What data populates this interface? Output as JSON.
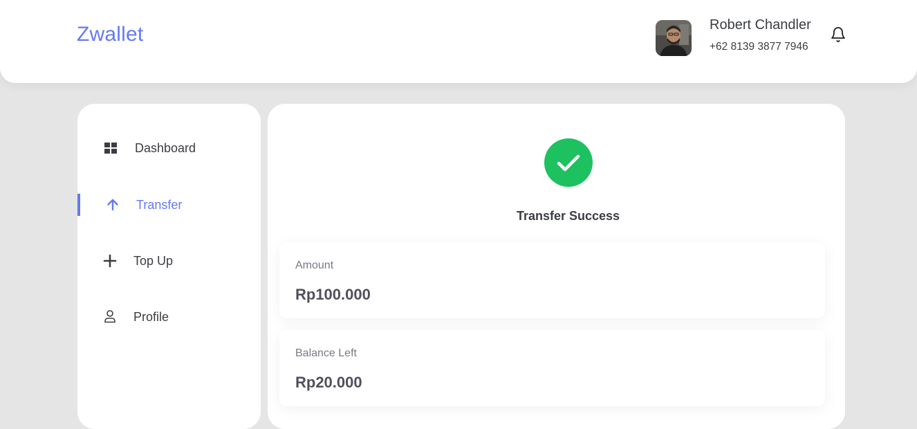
{
  "header": {
    "brand": "Zwallet",
    "user": {
      "name": "Robert Chandler",
      "phone": "+62 8139 3877 7946",
      "avatar": "user-photo"
    },
    "notification_icon": "bell-icon"
  },
  "sidebar": {
    "items": [
      {
        "label": "Dashboard",
        "icon": "grid-icon",
        "active": false
      },
      {
        "label": "Transfer",
        "icon": "arrow-up-icon",
        "active": true
      },
      {
        "label": "Top Up",
        "icon": "plus-icon",
        "active": false
      },
      {
        "label": "Profile",
        "icon": "user-icon",
        "active": false
      }
    ]
  },
  "main": {
    "status_icon": "check-icon",
    "title": "Transfer Success",
    "details": [
      {
        "label": "Amount",
        "value": "Rp100.000"
      },
      {
        "label": "Balance Left",
        "value": "Rp20.000"
      }
    ]
  },
  "colors": {
    "accent": "#6379f4",
    "success": "#1ec15f",
    "background": "#e5e5e5",
    "text": "#3a3d42"
  }
}
